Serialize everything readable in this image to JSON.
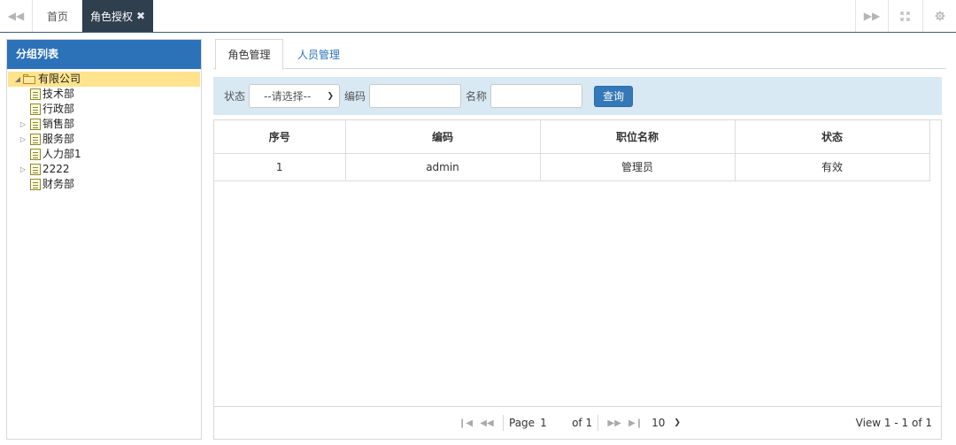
{
  "topbar": {
    "home_tab": "首页",
    "active_tab": "角色授权",
    "icons": {
      "back": "double-chevron-left-icon",
      "forward": "double-chevron-right-icon",
      "fullscreen": "expand-icon",
      "settings": "gear-icon",
      "close": "close-icon"
    }
  },
  "group_panel": {
    "title": "分组列表",
    "root": "有限公司",
    "children": [
      {
        "label": "技术部",
        "expandable": false
      },
      {
        "label": "行政部",
        "expandable": false
      },
      {
        "label": "销售部",
        "expandable": true
      },
      {
        "label": "服务部",
        "expandable": true
      },
      {
        "label": "人力部1",
        "expandable": false
      },
      {
        "label": "2222",
        "expandable": true
      },
      {
        "label": "财务部",
        "expandable": false
      }
    ]
  },
  "subtabs": {
    "role_tab": "角色管理",
    "member_tab": "人员管理"
  },
  "search": {
    "status_label": "状态",
    "status_value": "--请选择--",
    "code_label": "编码",
    "code_value": "",
    "name_label": "名称",
    "name_value": "",
    "query_button": "查询"
  },
  "table": {
    "columns": [
      "序号",
      "编码",
      "职位名称",
      "状态"
    ],
    "rows": [
      [
        "1",
        "admin",
        "管理员",
        "有效"
      ]
    ]
  },
  "pager": {
    "page_label": "Page",
    "page_value": "1",
    "of_text": "of 1",
    "page_size": "10",
    "view_text": "View 1 - 1 of 1"
  },
  "colors": {
    "header_blue": "#2b72b9",
    "active_tab_bg": "#2f3f4e",
    "search_bg": "#d8e9f4",
    "selected_node": "#ffe48d",
    "button_blue": "#3478b8"
  }
}
